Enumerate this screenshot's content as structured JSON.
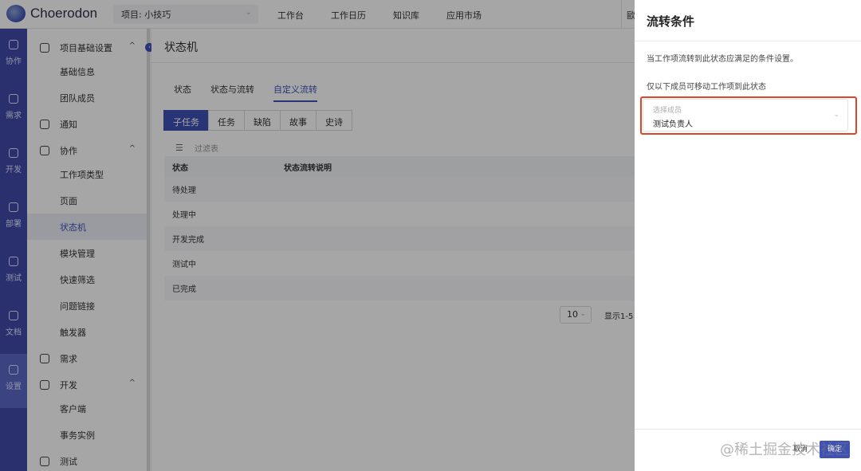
{
  "app": {
    "logo_text": "Choerodon"
  },
  "topbar": {
    "project": "项目: 小技巧",
    "nav": [
      "工作台",
      "工作日历",
      "知识库",
      "应用市场"
    ],
    "right_partial": "歐"
  },
  "rail": {
    "items": [
      {
        "label": "协作",
        "icon": "collab-icon"
      },
      {
        "label": "需求",
        "icon": "layers-icon"
      },
      {
        "label": "开发",
        "icon": "code-icon"
      },
      {
        "label": "部署",
        "icon": "deploy-icon"
      },
      {
        "label": "测试",
        "icon": "test-icon"
      },
      {
        "label": "文档",
        "icon": "doc-icon"
      },
      {
        "label": "设置",
        "icon": "settings-icon"
      }
    ]
  },
  "sidebar": {
    "items": [
      {
        "label": "项目基础设置",
        "type": "group",
        "icon": "palette-icon",
        "expanded": true
      },
      {
        "label": "基础信息",
        "type": "sub"
      },
      {
        "label": "团队成员",
        "type": "sub"
      },
      {
        "label": "通知",
        "type": "group",
        "icon": "bell-icon"
      },
      {
        "label": "协作",
        "type": "group",
        "icon": "collab-icon",
        "expanded": true
      },
      {
        "label": "工作项类型",
        "type": "sub"
      },
      {
        "label": "页面",
        "type": "sub"
      },
      {
        "label": "状态机",
        "type": "sub",
        "active": true
      },
      {
        "label": "模块管理",
        "type": "sub"
      },
      {
        "label": "快速筛选",
        "type": "sub"
      },
      {
        "label": "问题链接",
        "type": "sub"
      },
      {
        "label": "触发器",
        "type": "sub"
      },
      {
        "label": "需求",
        "type": "group",
        "icon": "list-icon"
      },
      {
        "label": "开发",
        "type": "group",
        "icon": "code-icon",
        "expanded": true
      },
      {
        "label": "客户端",
        "type": "sub"
      },
      {
        "label": "事务实例",
        "type": "sub"
      },
      {
        "label": "测试",
        "type": "group",
        "icon": "test-icon"
      }
    ]
  },
  "main": {
    "title": "状态机",
    "tabs": [
      "状态",
      "状态与流转",
      "自定义流转"
    ],
    "active_tab": "自定义流转",
    "type_tabs": [
      "子任务",
      "任务",
      "缺陷",
      "故事",
      "史诗"
    ],
    "active_type_tab": "子任务",
    "filter_placeholder": "过滤表",
    "table": {
      "columns": [
        "状态",
        "状态流转说明"
      ],
      "rows": [
        "待处理",
        "处理中",
        "开发完成",
        "测试中",
        "已完成"
      ]
    },
    "pagination": {
      "page_size": "10",
      "info": "显示1-5"
    }
  },
  "drawer": {
    "title": "流转条件",
    "description": "当工作项流转到此状态应满足的条件设置。",
    "member_label": "仅以下成员可移动工作项到此状态",
    "select": {
      "label": "选择成员",
      "value": "测试负责人"
    },
    "cancel": "取消",
    "ok": "确定",
    "highlight_color": "#e0452a"
  },
  "watermark": "@稀土掘金技术社区",
  "colors": {
    "primary": "#3f51b5",
    "rail": "#3f4aa8"
  }
}
